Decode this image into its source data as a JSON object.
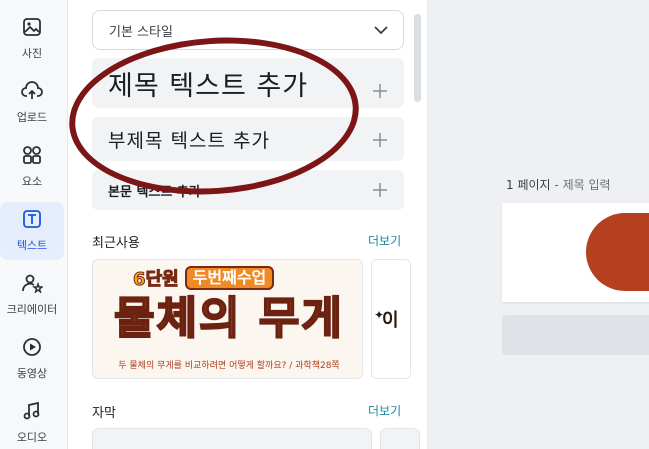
{
  "rail": {
    "items": [
      {
        "label": "사진",
        "icon": "image-icon"
      },
      {
        "label": "업로드",
        "icon": "cloud-upload-icon"
      },
      {
        "label": "요소",
        "icon": "elements-icon"
      },
      {
        "label": "텍스트",
        "icon": "text-icon"
      },
      {
        "label": "크리에이터",
        "icon": "creator-icon"
      },
      {
        "label": "동영상",
        "icon": "play-icon"
      },
      {
        "label": "오디오",
        "icon": "music-note-icon"
      }
    ]
  },
  "panel": {
    "style_select": "기본 스타일",
    "add_title": "제목 텍스트 추가",
    "add_subtitle": "부제목 텍스트 추가",
    "add_body": "본문 텍스트 추가",
    "recent": {
      "title": "최근사용",
      "more": "더보기",
      "thumb_line1_a": "6단원",
      "thumb_line1_b": "두번째수업",
      "thumb_big": "물체의 무게",
      "thumb_small": "두 물체의 무게를 비교하려면 어떻게 할까요? / 과학책28쪽",
      "side_text": "이"
    },
    "subtitle_section": {
      "title": "자막",
      "more": "더보기"
    }
  },
  "workspace": {
    "page_number": "1 페이지",
    "separator": "-",
    "page_title_placeholder": "제목 입력"
  },
  "colors": {
    "accent": "#1a56db",
    "annotation": "#7c1616",
    "page_shape": "#b5401f",
    "link": "#1b8aa0"
  }
}
